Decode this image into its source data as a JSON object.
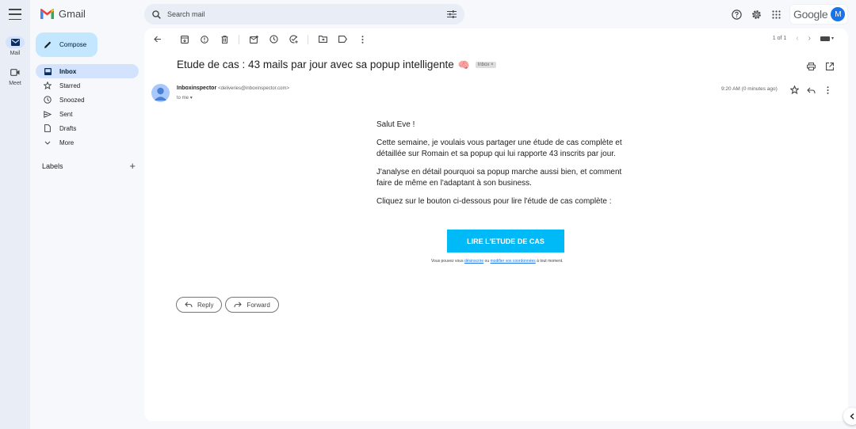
{
  "app": {
    "name": "Gmail",
    "colors": {
      "accent": "#0b57d0",
      "compose_bg": "#c2e7ff",
      "active_nav_bg": "#d3e3fd",
      "cta_bg": "#00b9f7",
      "avatar_bg": "#1a73e8"
    }
  },
  "rail": {
    "items": [
      {
        "label": "Mail",
        "icon": "mail-icon",
        "active": true
      },
      {
        "label": "Meet",
        "icon": "video-icon",
        "active": false
      }
    ]
  },
  "header": {
    "search_placeholder": "Search mail",
    "account_brand": "Google",
    "account_initial": "M",
    "icons": [
      "help-icon",
      "settings-icon",
      "apps-grid-icon",
      "search-options-icon"
    ]
  },
  "compose": {
    "label": "Compose"
  },
  "nav": {
    "items": [
      {
        "label": "Inbox",
        "icon": "inbox-icon",
        "active": true
      },
      {
        "label": "Starred",
        "icon": "star-icon",
        "active": false
      },
      {
        "label": "Snoozed",
        "icon": "clock-icon",
        "active": false
      },
      {
        "label": "Sent",
        "icon": "send-icon",
        "active": false
      },
      {
        "label": "Drafts",
        "icon": "draft-icon",
        "active": false
      },
      {
        "label": "More",
        "icon": "chevron-down-icon",
        "active": false
      }
    ],
    "labels_heading": "Labels",
    "add_label": "+"
  },
  "toolbar": {
    "pagination": "1 of 1",
    "icons": [
      "back-arrow-icon",
      "archive-icon",
      "report-spam-icon",
      "delete-icon",
      "mark-unread-icon",
      "snooze-icon",
      "add-task-icon",
      "move-to-icon",
      "label-icon",
      "more-vert-icon"
    ]
  },
  "email": {
    "subject": "Etude de cas : 43 mails par jour avec sa popup intelligente",
    "subject_emoji": "🧠",
    "label_badge": "Inbox ×",
    "sender_name": "Inboxinspector",
    "sender_email": "<deliveries@inboxinspector.com>",
    "to": "to me",
    "time": "9:20 AM (0 minutes ago)",
    "body": [
      "Salut Eve !",
      "Cette semaine, je voulais vous partager une étude de cas complète et détaillée sur Romain et sa popup qui lui rapporte 43 inscrits par jour.",
      "J'analyse en détail pourquoi sa popup marche aussi bien, et comment faire de même en l'adaptant à son business.",
      "Cliquez sur le bouton ci-dessous pour lire l'étude de cas complète :"
    ],
    "cta_label": "LIRE L'ETUDE DE CAS",
    "footer": {
      "prefix": "Vous pouvez vous ",
      "unsubscribe": "désinscrire",
      "middle": " ou ",
      "modify": "modifier vos coordonnées",
      "suffix": " à tout moment."
    }
  },
  "actions": {
    "reply": "Reply",
    "forward": "Forward"
  }
}
